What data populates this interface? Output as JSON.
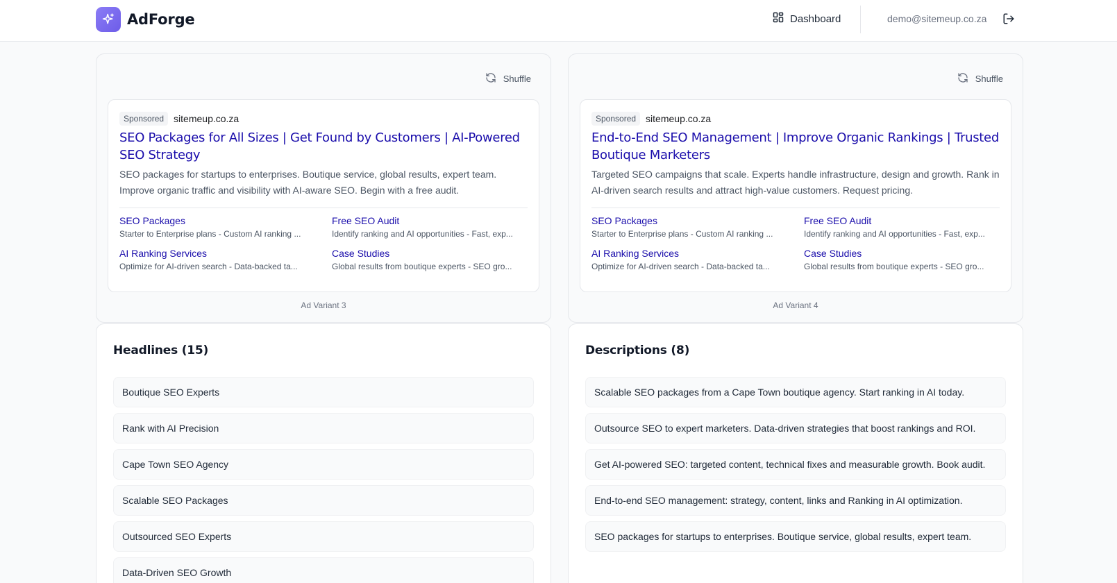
{
  "header": {
    "brand": "AdForge",
    "nav_dashboard": "Dashboard",
    "user_email": "demo@sitemeup.co.za",
    "accent_color": "#7c6cf0"
  },
  "ads": [
    {
      "shuffle_label": "Shuffle",
      "sponsored": "Sponsored",
      "domain": "sitemeup.co.za",
      "headline": "SEO Packages for All Sizes | Get Found by Customers | AI-Powered SEO Strategy",
      "description": "SEO packages for startups to enterprises. Boutique service, global results, expert team. Improve organic traffic and visibility with AI-aware SEO. Begin with a free audit.",
      "sitelinks": [
        {
          "title": "SEO Packages",
          "desc": "Starter to Enterprise plans - Custom AI ranking ..."
        },
        {
          "title": "Free SEO Audit",
          "desc": "Identify ranking and AI opportunities - Fast, exp..."
        },
        {
          "title": "AI Ranking Services",
          "desc": "Optimize for AI-driven search - Data-backed ta..."
        },
        {
          "title": "Case Studies",
          "desc": "Global results from boutique experts - SEO gro..."
        }
      ],
      "variant_label": "Ad Variant 3"
    },
    {
      "shuffle_label": "Shuffle",
      "sponsored": "Sponsored",
      "domain": "sitemeup.co.za",
      "headline": "End-to-End SEO Management | Improve Organic Rankings | Trusted Boutique Marketers",
      "description": "Targeted SEO campaigns that scale. Experts handle infrastructure, design and growth. Rank in AI-driven search results and attract high-value customers. Request pricing.",
      "sitelinks": [
        {
          "title": "SEO Packages",
          "desc": "Starter to Enterprise plans - Custom AI ranking ..."
        },
        {
          "title": "Free SEO Audit",
          "desc": "Identify ranking and AI opportunities - Fast, exp..."
        },
        {
          "title": "AI Ranking Services",
          "desc": "Optimize for AI-driven search - Data-backed ta..."
        },
        {
          "title": "Case Studies",
          "desc": "Global results from boutique experts - SEO gro..."
        }
      ],
      "variant_label": "Ad Variant 4"
    }
  ],
  "headlines": {
    "title": "Headlines (15)",
    "items": [
      "Boutique SEO Experts",
      "Rank with AI Precision",
      "Cape Town SEO Agency",
      "Scalable SEO Packages",
      "Outsourced SEO Experts",
      "Data-Driven SEO Growth"
    ]
  },
  "descriptions": {
    "title": "Descriptions (8)",
    "items": [
      "Scalable SEO packages from a Cape Town boutique agency. Start ranking in AI today.",
      "Outsource SEO to expert marketers. Data-driven strategies that boost rankings and ROI.",
      "Get AI-powered SEO: targeted content, technical fixes and measurable growth. Book audit.",
      "End-to-end SEO management: strategy, content, links and Ranking in AI optimization.",
      "SEO packages for startups to enterprises. Boutique service, global results, expert team."
    ]
  }
}
